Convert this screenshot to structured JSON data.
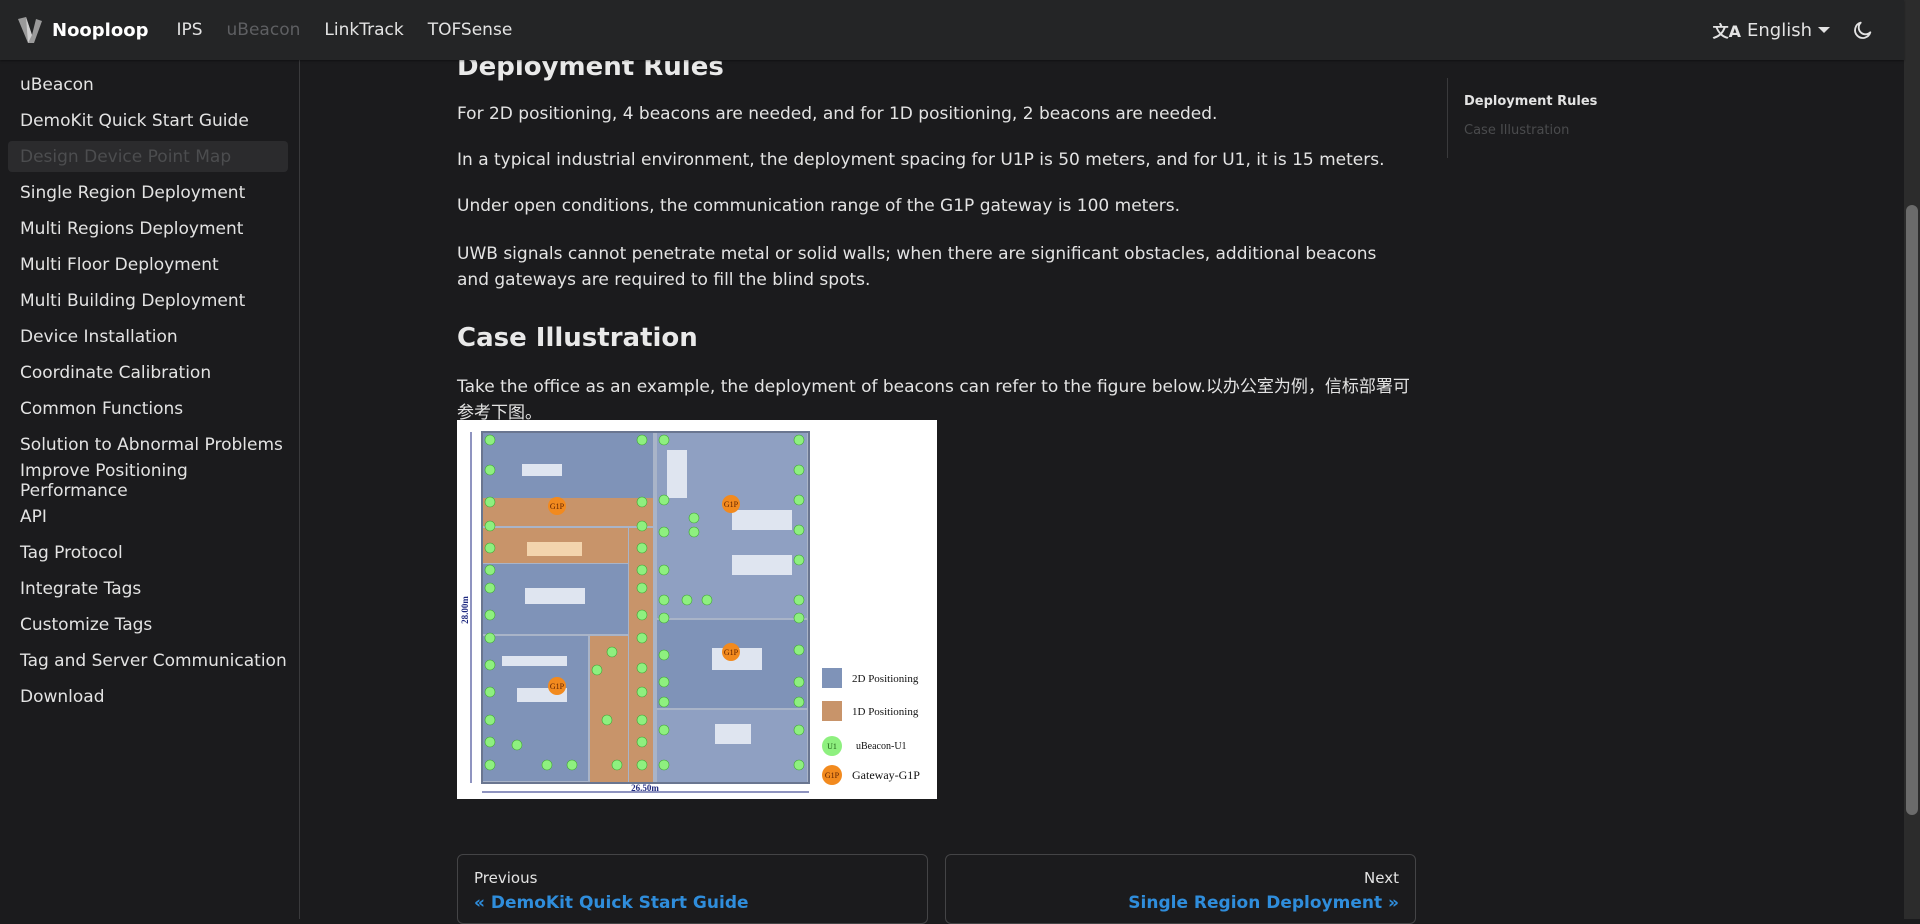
{
  "navbar": {
    "brand": "Nooploop",
    "links": [
      {
        "label": "IPS",
        "muted": false
      },
      {
        "label": "uBeacon",
        "muted": true
      },
      {
        "label": "LinkTrack",
        "muted": false
      },
      {
        "label": "TOFSense",
        "muted": false
      }
    ],
    "language": "English"
  },
  "sidebar": {
    "items": [
      {
        "label": "uBeacon"
      },
      {
        "label": "DemoKit Quick Start Guide"
      },
      {
        "label": "Design Device Point Map",
        "active": true
      },
      {
        "label": "Single Region Deployment"
      },
      {
        "label": "Multi Regions Deployment"
      },
      {
        "label": "Multi Floor Deployment"
      },
      {
        "label": "Multi Building Deployment"
      },
      {
        "label": "Device Installation"
      },
      {
        "label": "Coordinate Calibration"
      },
      {
        "label": "Common Functions"
      },
      {
        "label": "Solution to Abnormal Problems"
      },
      {
        "label": "Improve Positioning Performance"
      },
      {
        "label": "API"
      },
      {
        "label": "Tag Protocol"
      },
      {
        "label": "Integrate Tags"
      },
      {
        "label": "Customize Tags"
      },
      {
        "label": "Tag and Server Communication"
      },
      {
        "label": "Download"
      }
    ]
  },
  "main": {
    "section1_title": "Deployment Rules",
    "rules": [
      "For 2D positioning, 4 beacons are needed, and for 1D positioning, 2 beacons are needed.",
      "In a typical industrial environment, the deployment spacing for U1P is 50 meters, and for U1, it is 15 meters.",
      "Under open conditions, the communication range of the G1P gateway is 100 meters.",
      "UWB signals cannot penetrate metal or solid walls; when there are significant obstacles, additional beacons and gateways are required to fill the blind spots."
    ],
    "section2_title": "Case Illustration",
    "case_text": "Take the office as an example, the deployment of beacons can refer to the figure below.以办公室为例，信标部署可参考下图。",
    "figure": {
      "dim_height": "28.00m",
      "dim_width": "26.50m",
      "gateway_label": "G1P",
      "beacon_label": "U1",
      "legend": [
        {
          "label": "2D Positioning",
          "color": "#7f93b8"
        },
        {
          "label": "1D Positioning",
          "color": "#c8946a"
        },
        {
          "label": "uBeacon-U1",
          "color": "#8ef07f"
        },
        {
          "label": "Gateway-G1P",
          "color": "#f28a1e"
        }
      ]
    }
  },
  "toc": {
    "items": [
      {
        "label": "Deployment Rules"
      },
      {
        "label": "Case Illustration"
      }
    ]
  },
  "pager": {
    "prev_sub": "Previous",
    "prev_label": "« DemoKit Quick Start Guide",
    "next_sub": "Next",
    "next_label": "Single Region Deployment »"
  }
}
